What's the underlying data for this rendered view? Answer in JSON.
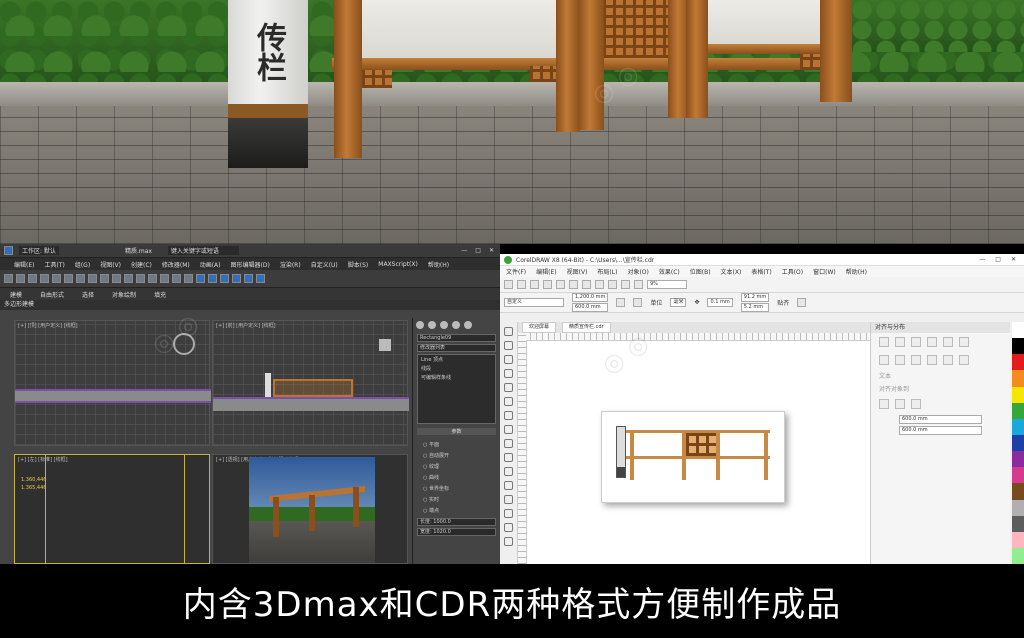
{
  "render": {
    "sign_text": "传栏"
  },
  "max": {
    "file_title": "精质.max",
    "workspace": "工作区: 默认",
    "search_placeholder": "键入关键字或短语",
    "menus": [
      "编辑(E)",
      "工具(T)",
      "组(G)",
      "视图(V)",
      "创建(C)",
      "修改器(M)",
      "动画(A)",
      "图形编辑器(D)",
      "渲染(R)",
      "自定义(U)",
      "脚本(S)",
      "MAXScript(X)",
      "帮助(H)"
    ],
    "ribbon_tabs": [
      "建模",
      "自由形式",
      "选择",
      "对象绘制",
      "填充"
    ],
    "sub_label": "多边形建模",
    "viewport_labels": [
      "[+] [顶] [用户定义] [线框]",
      "[+] [前] [用户定义] [线框]",
      "[+] [左] [标准] [线框]",
      "[+] [透视] [用户定义] [默认明暗处理]"
    ],
    "object_name": "Rectangle09",
    "modifier_list_label": "修改器列表",
    "stack_items": [
      "Line 顶点",
      "线段",
      "可编辑样条线"
    ],
    "params_label": "参数",
    "radio_items": [
      "平面",
      "自动展开",
      "纹理",
      "曲线",
      "世界坐标",
      "实时",
      "端点"
    ],
    "dims": [
      "1.360,446",
      "1.365,446"
    ],
    "bottom_fields": [
      "长度: 1000.0",
      "宽度: 1020.0"
    ]
  },
  "cdr": {
    "title": "CorelDRAW X8 (64-Bit) - C:\\Users\\...\\宣传栏.cdr",
    "menus": [
      "文件(F)",
      "编辑(E)",
      "视图(V)",
      "布局(L)",
      "对象(O)",
      "效果(C)",
      "位图(B)",
      "文本(X)",
      "表格(T)",
      "工具(O)",
      "窗口(W)",
      "帮助(H)"
    ],
    "zoom": "9%",
    "preset": "自定义",
    "width_value": "1,200.0 mm",
    "height_value": "600.0 mm",
    "unit_label": "单位",
    "unit_value": "毫米",
    "nudge": "0.1 mm",
    "dup_x": "91.2 mm",
    "dup_y": "5.2 mm",
    "snap_label": "贴齐",
    "tabs": [
      "欢迎屏幕",
      "精质宣传栏.cdr"
    ],
    "docker_title": "对齐与分布",
    "docker_text_label": "文本",
    "docker_obj_label": "对齐对象到",
    "docker_val1": "600.0 mm",
    "docker_val2": "600.0 mm",
    "palette_colors": [
      "#ffffff",
      "#000000",
      "#e21b1b",
      "#f28c1c",
      "#f6e500",
      "#35a63a",
      "#1aa7d9",
      "#1e3fa6",
      "#8a2c9d",
      "#d63a8c",
      "#7a4a1f",
      "#b0b0b0",
      "#5c5c5c",
      "#ffb6c1",
      "#90ee90"
    ]
  },
  "caption": {
    "text": "内含3Dmax和CDR两种格式方便制作成品"
  },
  "colors": {
    "wood": "#b97332",
    "max_bg": "#444444",
    "cdr_bg": "#f0f0f0"
  }
}
